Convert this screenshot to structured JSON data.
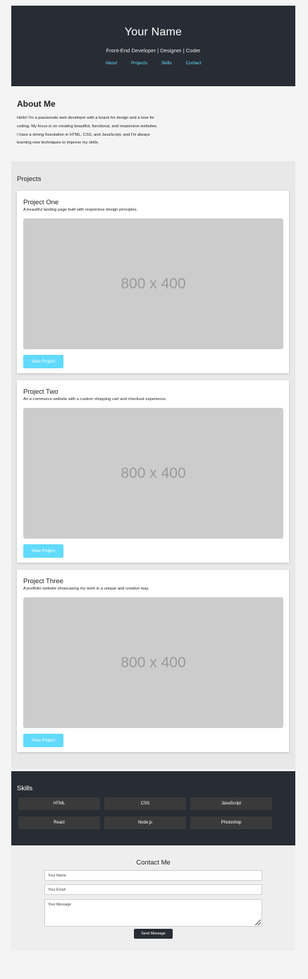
{
  "header": {
    "name": "Your Name",
    "tagline": "Front-End Developer | Designer | Coder",
    "nav": [
      "About",
      "Projects",
      "Skills",
      "Contact"
    ]
  },
  "about": {
    "title": "About Me",
    "lines": [
      "Hello! I'm a passionate web developer with a knack for design and a love for",
      "coding. My focus is on creating beautiful, functional, and responsive websites.",
      "I have a strong foundation in HTML, CSS, and JavaScript, and I'm always",
      "learning new techniques to improve my skills."
    ]
  },
  "projects": {
    "title": "Projects",
    "items": [
      {
        "title": "Project One",
        "description": "A beautiful landing page built with responsive design principles.",
        "image_text": "800 x 400",
        "button": "View Project"
      },
      {
        "title": "Project Two",
        "description": "An e-commerce website with a custom shopping cart and checkout experience.",
        "image_text": "800 x 400",
        "button": "View Project"
      },
      {
        "title": "Project Three",
        "description": "A portfolio website showcasing my work in a unique and creative way.",
        "image_text": "800 x 400",
        "button": "View Project"
      }
    ]
  },
  "skills": {
    "title": "Skills",
    "items": [
      "HTML",
      "CSS",
      "JavaScript",
      "React",
      "Node.js",
      "Photoshop"
    ]
  },
  "contact": {
    "title": "Contact Me",
    "name_placeholder": "Your Name",
    "email_placeholder": "Your Email",
    "message_placeholder": "Your Message",
    "send_label": "Send Message"
  },
  "colors": {
    "dark": "#282c34",
    "accent": "#61dafb",
    "placeholder_bg": "#cccccc"
  }
}
